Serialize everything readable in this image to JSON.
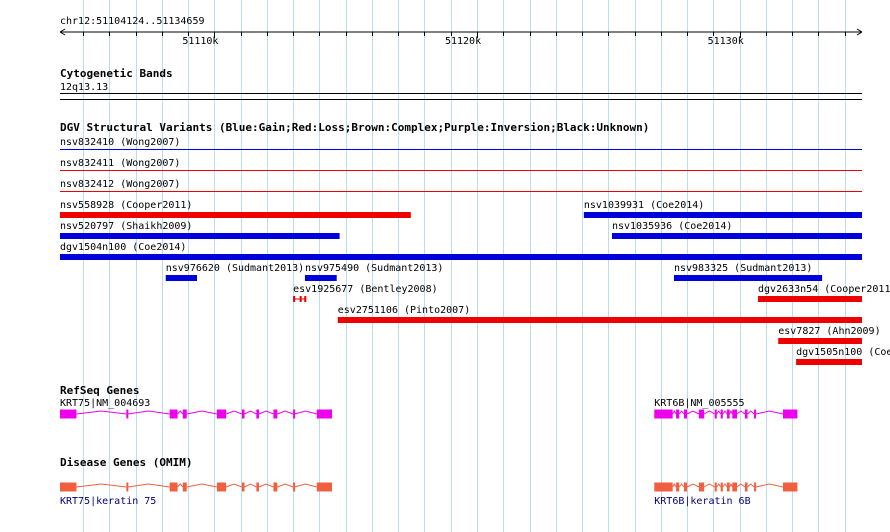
{
  "region": "chr12:51104124..51134659",
  "ruler": {
    "start": 51104124,
    "end": 51134659,
    "ticks": [
      {
        "pos": 51110000,
        "label": "51110k"
      },
      {
        "pos": 51120000,
        "label": "51120k"
      },
      {
        "pos": 51130000,
        "label": "51130k"
      }
    ]
  },
  "tracks": {
    "cytoband": {
      "title": "Cytogenetic Bands",
      "band": "12q13.13"
    },
    "dgv": {
      "title": "DGV Structural Variants (Blue:Gain;Red:Loss;Brown:Complex;Purple:Inversion;Black:Unknown)",
      "colors": {
        "gain": "#0000dd",
        "loss": "#ee0000"
      },
      "features": [
        {
          "label": "nsv832410 (Wong2007)",
          "type": "gain",
          "start": 51104124,
          "end": 51134659,
          "thin": true,
          "row": 0
        },
        {
          "label": "nsv832411 (Wong2007)",
          "type": "loss",
          "start": 51104124,
          "end": 51134659,
          "thin": true,
          "row": 1
        },
        {
          "label": "nsv832412 (Wong2007)",
          "type": "loss",
          "start": 51104124,
          "end": 51134659,
          "thin": true,
          "row": 2
        },
        {
          "label": "nsv558928 (Cooper2011)",
          "type": "loss",
          "start": 51104124,
          "end": 51117480,
          "row": 3
        },
        {
          "label": "nsv1039931 (Coe2014)",
          "type": "gain",
          "start": 51124070,
          "end": 51134659,
          "row": 3
        },
        {
          "label": "nsv520797 (Shaikh2009)",
          "type": "gain",
          "start": 51104124,
          "end": 51114770,
          "row": 4
        },
        {
          "label": "nsv1035936 (Coe2014)",
          "type": "gain",
          "start": 51125140,
          "end": 51134659,
          "row": 4
        },
        {
          "label": "dgv1504n100 (Coe2014)",
          "type": "gain",
          "start": 51104124,
          "end": 51134659,
          "row": 5
        },
        {
          "label": "nsv976620 (Sudmant2013)",
          "type": "gain",
          "start": 51108150,
          "end": 51109340,
          "row": 6
        },
        {
          "label": "nsv975490 (Sudmant2013)",
          "type": "gain",
          "start": 51113450,
          "end": 51114660,
          "row": 6
        },
        {
          "label": "nsv983325 (Sudmant2013)",
          "type": "gain",
          "start": 51127500,
          "end": 51133140,
          "row": 6
        },
        {
          "label": "esv1925677 (Bentley2008)",
          "type": "loss",
          "start": 51113000,
          "end": 51113500,
          "row": 7,
          "exons": true
        },
        {
          "label": "dgv2633n54 (Cooper2011)",
          "type": "loss",
          "start": 51130700,
          "end": 51134659,
          "row": 7
        },
        {
          "label": "esv2751106 (Pinto2007)",
          "type": "loss",
          "start": 51114700,
          "end": 51134659,
          "row": 8
        },
        {
          "label": "esv7827 (Ahn2009)",
          "type": "loss",
          "start": 51131470,
          "end": 51134659,
          "row": 9
        },
        {
          "label": "dgv1505n100 (Coe",
          "type": "loss",
          "start": 51132150,
          "end": 51134659,
          "row": 10
        }
      ]
    },
    "refseq": {
      "title": "RefSeq Genes",
      "color": "#ee00ee",
      "genes": [
        {
          "label": "KRT75|NM_004693",
          "start": 51104124,
          "end": 51114480,
          "exons": [
            [
              51104124,
              51104750
            ],
            [
              51106650,
              51106700
            ],
            [
              51108300,
              51108600
            ],
            [
              51108800,
              51108950
            ],
            [
              51110100,
              51110450
            ],
            [
              51111050,
              51111150
            ],
            [
              51111600,
              51111700
            ],
            [
              51112250,
              51112400
            ],
            [
              51113000,
              51113050
            ],
            [
              51113900,
              51114480
            ]
          ]
        },
        {
          "label": "KRT6B|NM_005555",
          "start": 51126750,
          "end": 51132200,
          "exons": [
            [
              51126750,
              51127450
            ],
            [
              51127580,
              51127700
            ],
            [
              51127880,
              51128000
            ],
            [
              51128450,
              51128650
            ],
            [
              51129050,
              51129130
            ],
            [
              51129280,
              51129360
            ],
            [
              51129520,
              51129620
            ],
            [
              51129720,
              51129900
            ],
            [
              51130200,
              51130300
            ],
            [
              51130550,
              51130620
            ],
            [
              51131650,
              51132200
            ]
          ]
        }
      ]
    },
    "omim": {
      "title": "Disease Genes (OMIM)",
      "color": "#f06040",
      "labelcolor": "#000080",
      "genes": [
        {
          "label": "KRT75|keratin 75"
        },
        {
          "label": "KRT6B|keratin 6B"
        }
      ]
    }
  }
}
